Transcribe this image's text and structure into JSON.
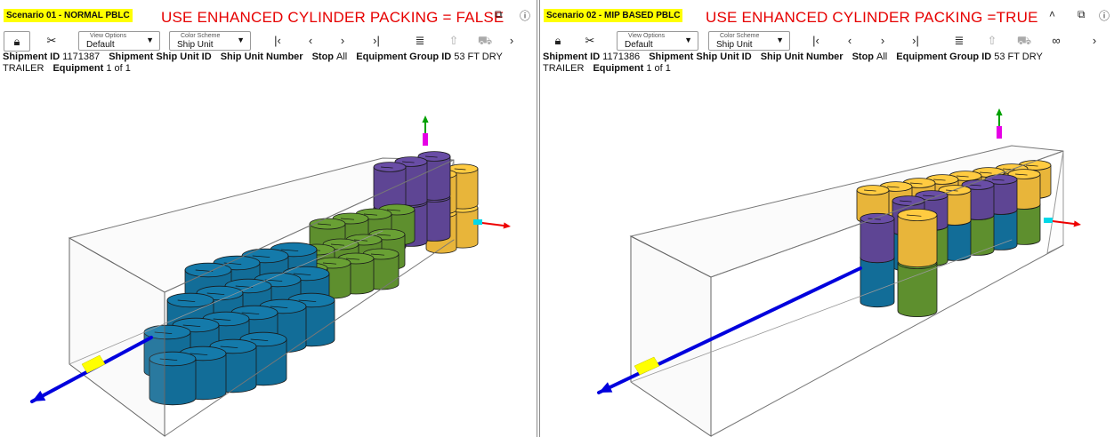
{
  "left": {
    "scenario_label": "Scenario 01 - NORMAL PBLC",
    "note": "USE ENHANCED CYLINDER PACKING = FALSE",
    "view_options": {
      "label": "View Options",
      "value": "Default"
    },
    "color_scheme": {
      "label": "Color Scheme",
      "value": "Ship Unit"
    },
    "info": {
      "shipment_id_label": "Shipment ID",
      "shipment_id": "1171387",
      "ship_unit_id_label": "Shipment Ship Unit ID",
      "ship_unit_number_label": "Ship Unit Number",
      "stop_label": "Stop",
      "stop": "All",
      "equipment_group_label": "Equipment Group ID",
      "equipment_group_a": "53 FT DRY",
      "equipment_group_b": "TRAILER",
      "equipment_label": "Equipment",
      "equipment": "1 of 1"
    }
  },
  "right": {
    "scenario_label": "Scenario 02 - MIP BASED PBLC",
    "note": "USE ENHANCED CYLINDER PACKING =TRUE",
    "view_options": {
      "label": "View Options",
      "value": "Default"
    },
    "color_scheme": {
      "label": "Color Scheme",
      "value": "Ship Unit"
    },
    "info": {
      "shipment_id_label": "Shipment ID",
      "shipment_id": "1171386",
      "ship_unit_id_label": "Shipment Ship Unit ID",
      "ship_unit_number_label": "Ship Unit Number",
      "stop_label": "Stop",
      "stop": "All",
      "equipment_group_label": "Equipment Group ID",
      "equipment_group_a": "53 FT DRY",
      "equipment_group_b": "TRAILER",
      "equipment_label": "Equipment",
      "equipment": "1 of 1"
    }
  },
  "colors": {
    "blue": "#126d98",
    "green": "#5e8f2e",
    "purple": "#5e4594",
    "gold": "#e8b53a",
    "axis_x": "#0000dd",
    "axis_y": "#00a000",
    "axis_z": "#ee0000",
    "highlight": "#ffff00"
  },
  "icons": [
    "lock-icon",
    "tools-icon",
    "first-icon",
    "prev-icon",
    "next-icon",
    "last-icon",
    "stack-icon",
    "unload-icon",
    "truck-icon",
    "glasses-icon",
    "more-icon",
    "popout-icon",
    "info-icon",
    "collapse-icon"
  ]
}
